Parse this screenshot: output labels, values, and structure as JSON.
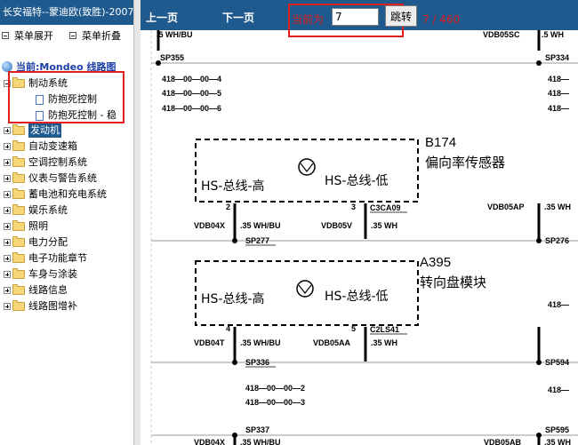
{
  "window": {
    "title": "长安福特--蒙迪欧(致胜)-2007"
  },
  "left_pane": {
    "expand_all": "菜单展开",
    "collapse_all": "菜单折叠",
    "root_label": "当前:Mondeo 线路图",
    "tree": [
      {
        "label": "制动系统",
        "expanded": true
      },
      {
        "label": "防抱死控制",
        "child": true
      },
      {
        "label": "防抱死控制 - 稳",
        "child": true
      },
      {
        "label": "发动机",
        "selected": true
      },
      {
        "label": "自动变速箱"
      },
      {
        "label": "空调控制系统"
      },
      {
        "label": "仪表与警告系统"
      },
      {
        "label": "蓄电池和充电系统"
      },
      {
        "label": "娱乐系统"
      },
      {
        "label": "照明"
      },
      {
        "label": "电力分配"
      },
      {
        "label": "电子功能章节"
      },
      {
        "label": "车身与涂装"
      },
      {
        "label": "线路信息"
      },
      {
        "label": "线路图增补"
      }
    ]
  },
  "nav": {
    "prev": "上一页",
    "next": "下一页",
    "current_label": "当前为",
    "current_page": "7",
    "jump_button": "跳转",
    "page_count": "7 / 460"
  },
  "diagram": {
    "top_left_wire": ".5 WH/BU",
    "top_right_wire_code": "VDB05SC",
    "top_right_wire": ".5 WH",
    "splice_sp355": "SP355",
    "splice_sp334": "SP334",
    "refs_left_1": [
      "418—00—00—4",
      "418—00—00—5",
      "418—00—00—6"
    ],
    "refs_right_1": [
      "418—",
      "418—",
      "418—"
    ],
    "module1_id": "B174",
    "module1_name": "偏向率传感器",
    "can_high": "HS-总线-高",
    "can_low": "HS-总线-低",
    "pin_2": "2",
    "pin_3": "3",
    "wire_c3ca09": "C3CA09",
    "wire_vdb04x": "VDB04X",
    "wire_35_whbu": ".35 WH/BU",
    "wire_vdb05v": "VDB05V",
    "wire_35_wh": ".35 WH",
    "wire_vdb05ap": "VDB05AP",
    "splice_sp277": "SP277",
    "splice_sp276": "SP276",
    "module2_id": "A395",
    "module2_name": "转向盘模块",
    "right_ref_mid": "418—",
    "pin_4": "4",
    "pin_5": "5",
    "wire_c2ls41": "C2LS41",
    "wire_vdb04t": "VDB04T",
    "wire_vdb05aa": "VDB05AA",
    "splice_sp336": "SP336",
    "splice_sp594": "SP594",
    "refs_left_2": [
      "418—00—00—2",
      "418—00—00—3"
    ],
    "right_ref_low": "418—",
    "splice_sp337": "SP337",
    "splice_sp595": "SP595",
    "bottom_left_code": "VDB04X",
    "bottom_left_wire": ".35 WH/BU",
    "bottom_right_code": "VDB05AB",
    "bottom_right_wire": ".35 WH"
  }
}
